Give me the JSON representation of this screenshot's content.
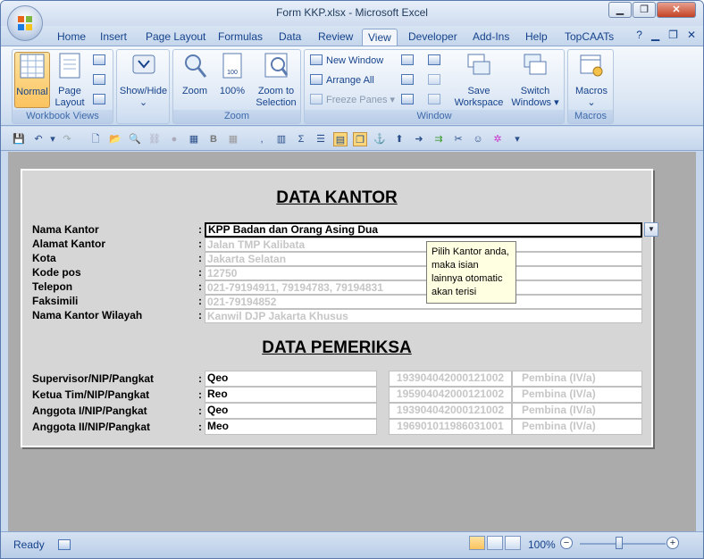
{
  "window": {
    "title": "Form KKP.xlsx - Microsoft Excel"
  },
  "tabs": [
    "Home",
    "Insert",
    "Page Layout",
    "Formulas",
    "Data",
    "Review",
    "View",
    "Developer",
    "Add-Ins",
    "Help",
    "TopCAATs"
  ],
  "active_tab": "View",
  "ribbon": {
    "workbook_views": {
      "label": "Workbook Views",
      "normal": "Normal",
      "page": "Page",
      "layout": "Layout"
    },
    "show_hide": {
      "label": "Show/Hide"
    },
    "zoom": {
      "label": "Zoom",
      "zoom": "Zoom",
      "hundred": "100%",
      "zoom_to": "Zoom to",
      "selection": "Selection"
    },
    "window": {
      "label": "Window",
      "new_window": "New Window",
      "arrange_all": "Arrange All",
      "freeze_panes": "Freeze Panes",
      "save": "Save",
      "workspace": "Workspace",
      "switch": "Switch",
      "windows": "Windows"
    },
    "macros": {
      "label": "Macros",
      "macros": "Macros"
    }
  },
  "form": {
    "title_kantor": "DATA KANTOR",
    "title_pemeriksa": "DATA PEMERIKSA",
    "kantor_fields": [
      {
        "label": "Nama Kantor",
        "value": "KPP Badan dan Orang Asing Dua"
      },
      {
        "label": "Alamat Kantor",
        "value": "Jalan TMP Kalibata"
      },
      {
        "label": "Kota",
        "value": "Jakarta Selatan"
      },
      {
        "label": "Kode pos",
        "value": "12750"
      },
      {
        "label": "Telepon",
        "value": "021-79194911, 79194783, 79194831"
      },
      {
        "label": "Faksimili",
        "value": "021-79194852"
      },
      {
        "label": "Nama Kantor Wilayah",
        "value": "Kanwil DJP Jakarta Khusus"
      }
    ],
    "colon": ":",
    "pemeriksa": [
      {
        "label": "Supervisor/NIP/Pangkat",
        "name": "Qeo",
        "nip": "193904042000121002",
        "pangkat": "Pembina (IV/a)"
      },
      {
        "label": "Ketua Tim/NIP/Pangkat",
        "name": "Reo",
        "nip": "195904042000121002",
        "pangkat": "Pembina (IV/a)"
      },
      {
        "label": "Anggota I/NIP/Pangkat",
        "name": "Qeo",
        "nip": "193904042000121002",
        "pangkat": "Pembina (IV/a)"
      },
      {
        "label": "Anggota II/NIP/Pangkat",
        "name": "Meo",
        "nip": "196901011986031001",
        "pangkat": "Pembina (IV/a)"
      }
    ],
    "tooltip": "Pilih Kantor anda, maka isian lainnya otomatic akan terisi"
  },
  "status": {
    "ready": "Ready",
    "zoom": "100%"
  }
}
